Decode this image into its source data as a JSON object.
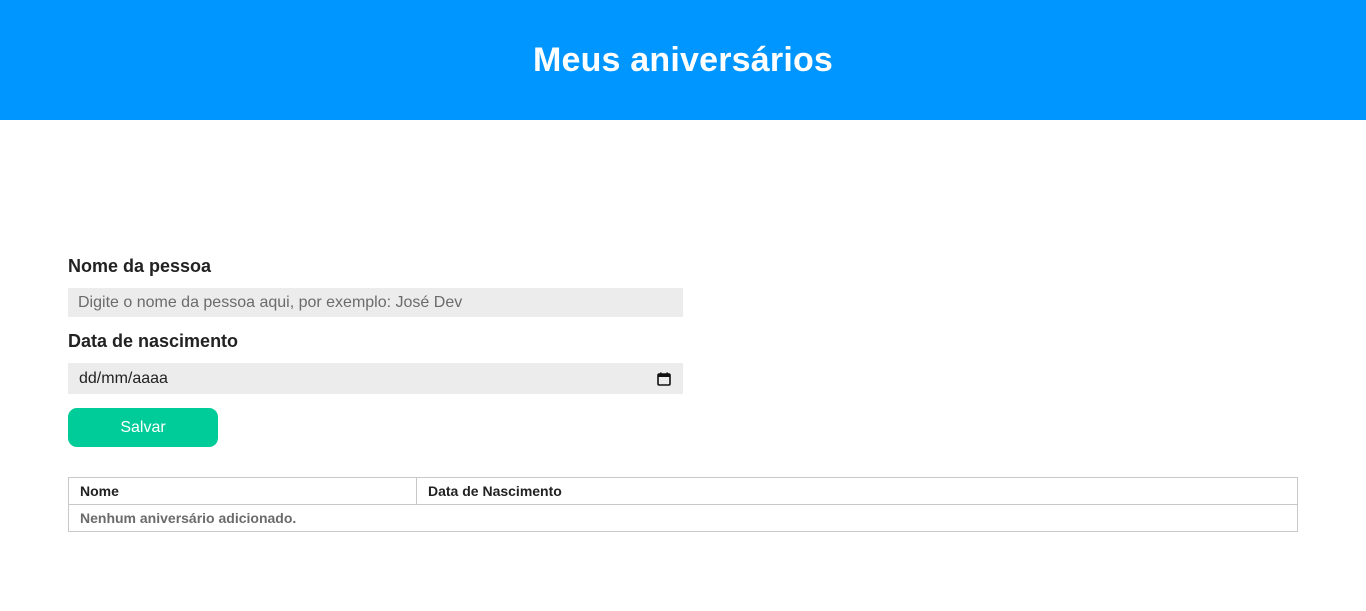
{
  "header": {
    "title": "Meus aniversários"
  },
  "form": {
    "name_label": "Nome da pessoa",
    "name_placeholder": "Digite o nome da pessoa aqui, por exemplo: José Dev",
    "name_value": "",
    "date_label": "Data de nascimento",
    "date_value": "dd/mm/aaaa",
    "date_icon": "calendar-icon",
    "save_label": "Salvar"
  },
  "table": {
    "columns": [
      "Nome",
      "Data de Nascimento"
    ],
    "empty_message": "Nenhum aniversário adicionado."
  },
  "colors": {
    "header_bg": "#0096ff",
    "save_button_bg": "#00cc99",
    "input_bg": "#ececec"
  }
}
